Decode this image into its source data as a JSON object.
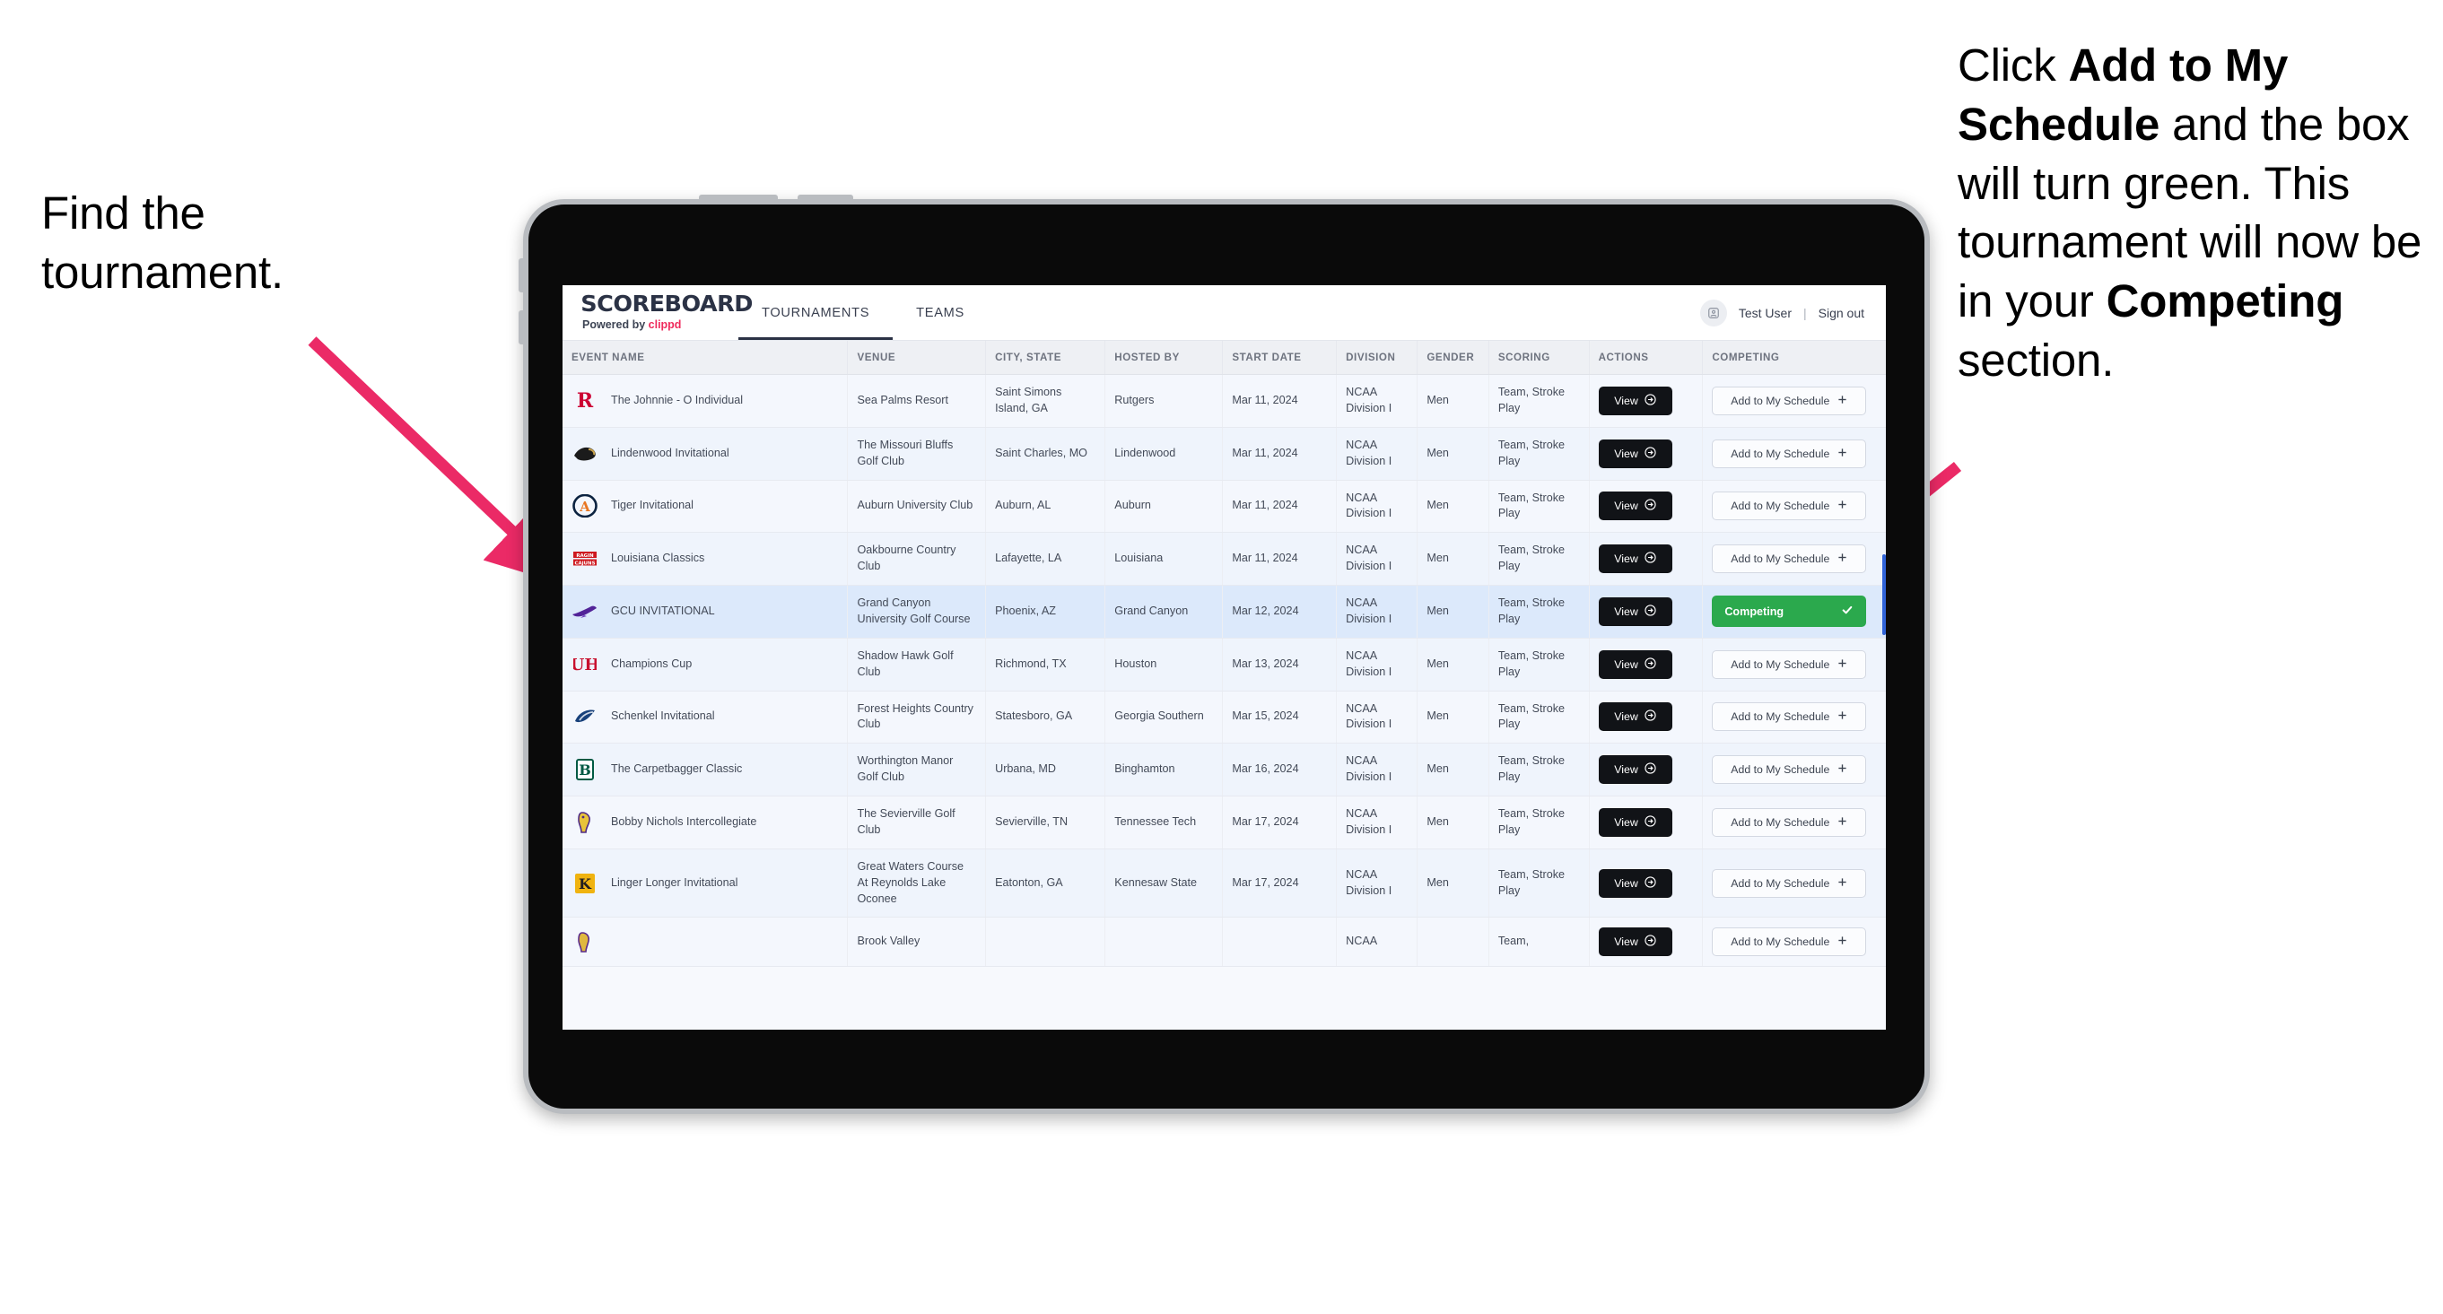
{
  "annotations": {
    "left": {
      "text": "Find the tournament."
    },
    "right": {
      "p1": "Click ",
      "b1": "Add to My Schedule",
      "p2": " and the box will turn green. This tournament will now be in your ",
      "b2": "Competing",
      "p3": " section."
    }
  },
  "app": {
    "brand": {
      "wordmark": "SCOREBOARD",
      "powered_prefix": "Powered by ",
      "powered_brand": "clippd"
    },
    "tabs": [
      {
        "label": "TOURNAMENTS",
        "active": true
      },
      {
        "label": "TEAMS",
        "active": false
      }
    ],
    "user": {
      "avatar_icon": "user-avatar-icon",
      "name": "Test User",
      "separator": "|",
      "sign_out": "Sign out"
    }
  },
  "table": {
    "columns": [
      "EVENT NAME",
      "VENUE",
      "CITY, STATE",
      "HOSTED BY",
      "START DATE",
      "DIVISION",
      "GENDER",
      "SCORING",
      "ACTIONS",
      "COMPETING"
    ],
    "action_label": "View",
    "action_icon": "arrow-circle-right-icon",
    "add_label": "Add to My Schedule",
    "add_icon": "plus-icon",
    "competing_label": "Competing",
    "competing_icon": "check-icon",
    "competing_color": "#2ba94d",
    "rows": [
      {
        "logo": "rutgers-logo",
        "name": "The Johnnie - O Individual",
        "venue": "Sea Palms Resort",
        "city": "Saint Simons Island, GA",
        "host": "Rutgers",
        "date": "Mar 11, 2024",
        "division": "NCAA Division I",
        "gender": "Men",
        "scoring": "Team, Stroke Play",
        "competing": false
      },
      {
        "logo": "lindenwood-logo",
        "name": "Lindenwood Invitational",
        "venue": "The Missouri Bluffs Golf Club",
        "city": "Saint Charles, MO",
        "host": "Lindenwood",
        "date": "Mar 11, 2024",
        "division": "NCAA Division I",
        "gender": "Men",
        "scoring": "Team, Stroke Play",
        "competing": false
      },
      {
        "logo": "auburn-logo",
        "name": "Tiger Invitational",
        "venue": "Auburn University Club",
        "city": "Auburn, AL",
        "host": "Auburn",
        "date": "Mar 11, 2024",
        "division": "NCAA Division I",
        "gender": "Men",
        "scoring": "Team, Stroke Play",
        "competing": false
      },
      {
        "logo": "louisiana-logo",
        "name": "Louisiana Classics",
        "venue": "Oakbourne Country Club",
        "city": "Lafayette, LA",
        "host": "Louisiana",
        "date": "Mar 11, 2024",
        "division": "NCAA Division I",
        "gender": "Men",
        "scoring": "Team, Stroke Play",
        "competing": false
      },
      {
        "logo": "gcu-logo",
        "name": "GCU INVITATIONAL",
        "venue": "Grand Canyon University Golf Course",
        "city": "Phoenix, AZ",
        "host": "Grand Canyon",
        "date": "Mar 12, 2024",
        "division": "NCAA Division I",
        "gender": "Men",
        "scoring": "Team, Stroke Play",
        "competing": true
      },
      {
        "logo": "houston-logo",
        "name": "Champions Cup",
        "venue": "Shadow Hawk Golf Club",
        "city": "Richmond, TX",
        "host": "Houston",
        "date": "Mar 13, 2024",
        "division": "NCAA Division I",
        "gender": "Men",
        "scoring": "Team, Stroke Play",
        "competing": false
      },
      {
        "logo": "georgia-southern-logo",
        "name": "Schenkel Invitational",
        "venue": "Forest Heights Country Club",
        "city": "Statesboro, GA",
        "host": "Georgia Southern",
        "date": "Mar 15, 2024",
        "division": "NCAA Division I",
        "gender": "Men",
        "scoring": "Team, Stroke Play",
        "competing": false
      },
      {
        "logo": "binghamton-logo",
        "name": "The Carpetbagger Classic",
        "venue": "Worthington Manor Golf Club",
        "city": "Urbana, MD",
        "host": "Binghamton",
        "date": "Mar 16, 2024",
        "division": "NCAA Division I",
        "gender": "Men",
        "scoring": "Team, Stroke Play",
        "competing": false
      },
      {
        "logo": "tennessee-tech-logo",
        "name": "Bobby Nichols Intercollegiate",
        "venue": "The Sevierville Golf Club",
        "city": "Sevierville, TN",
        "host": "Tennessee Tech",
        "date": "Mar 17, 2024",
        "division": "NCAA Division I",
        "gender": "Men",
        "scoring": "Team, Stroke Play",
        "competing": false
      },
      {
        "logo": "kennesaw-logo",
        "name": "Linger Longer Invitational",
        "venue": "Great Waters Course At Reynolds Lake Oconee",
        "city": "Eatonton, GA",
        "host": "Kennesaw State",
        "date": "Mar 17, 2024",
        "division": "NCAA Division I",
        "gender": "Men",
        "scoring": "Team, Stroke Play",
        "competing": false
      },
      {
        "logo": "ecu-logo",
        "name": "",
        "venue": "Brook Valley",
        "city": "",
        "host": "",
        "date": "",
        "division": "NCAA",
        "gender": "",
        "scoring": "Team,",
        "competing": false
      }
    ]
  }
}
